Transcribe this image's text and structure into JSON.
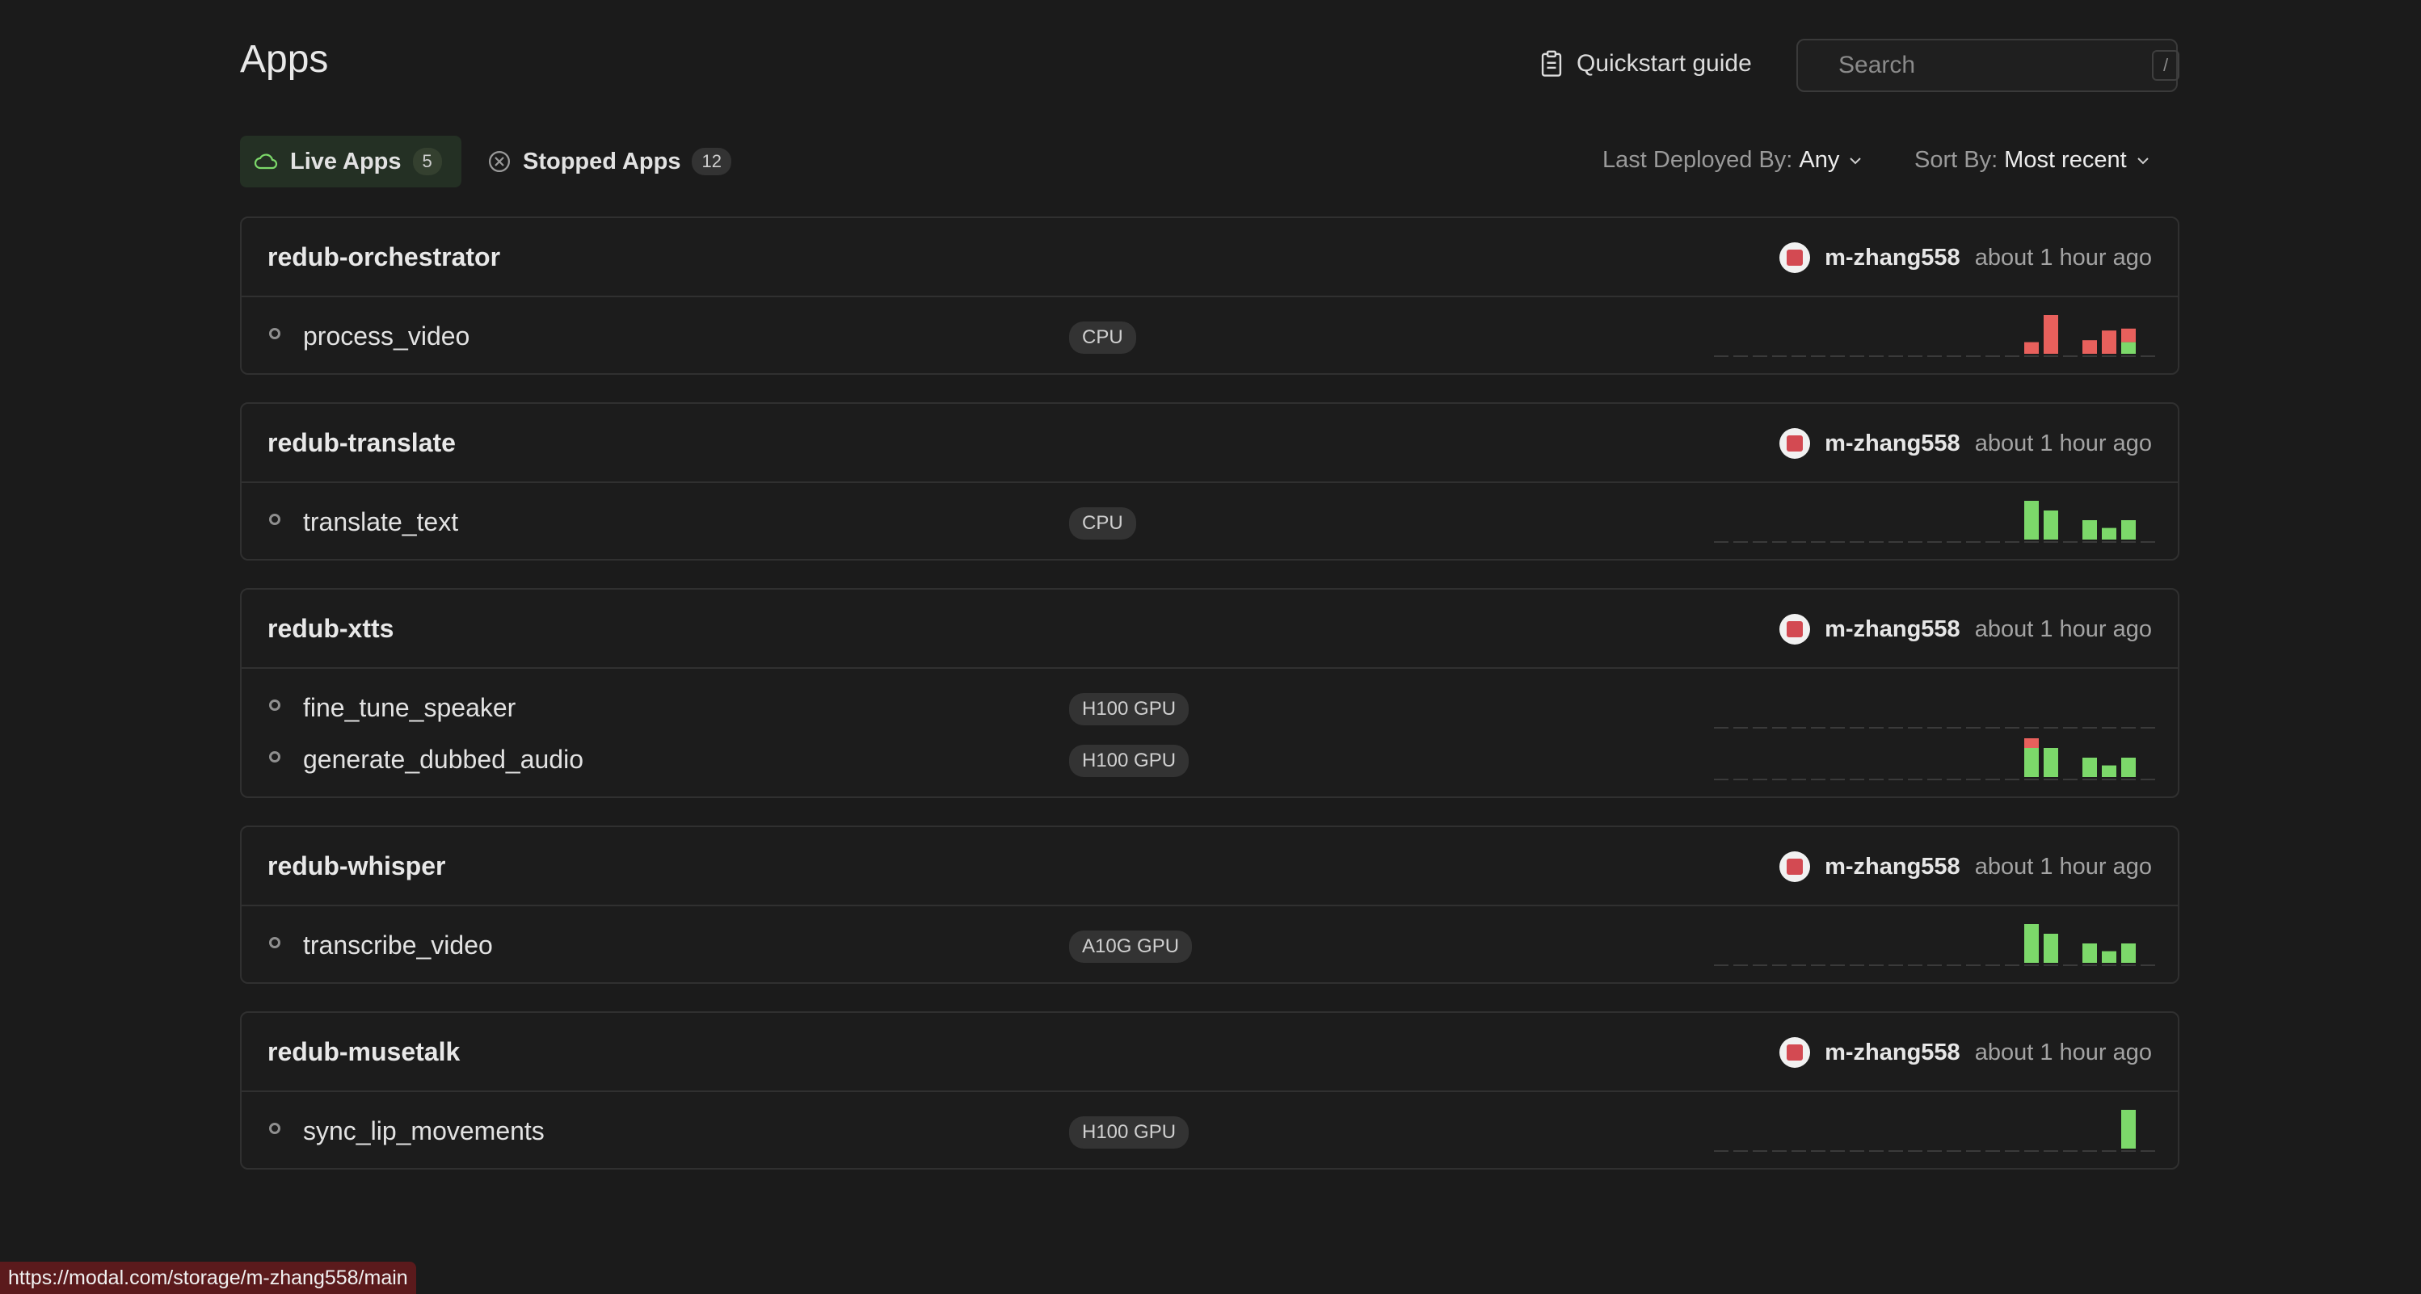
{
  "header": {
    "title": "Apps",
    "quickstart_label": "Quickstart guide",
    "search_placeholder": "Search",
    "search_shortcut": "/"
  },
  "tabs": [
    {
      "label": "Live Apps",
      "count": "5",
      "active": true
    },
    {
      "label": "Stopped Apps",
      "count": "12",
      "active": false
    }
  ],
  "filters": {
    "deployed_by_label": "Last Deployed By:",
    "deployed_by_value": "Any",
    "sort_label": "Sort By:",
    "sort_value": "Most recent"
  },
  "colors": {
    "success": "#7cd86a",
    "failure": "#e8605c",
    "dash": "#3a3a3a"
  },
  "apps": [
    {
      "name": "redub-orchestrator",
      "user": "m-zhang558",
      "time": "about 1 hour ago",
      "functions": [
        {
          "name": "process_video",
          "resource": "CPU",
          "activity": [
            [
              0,
              0
            ],
            [
              0,
              0
            ],
            [
              0,
              0
            ],
            [
              0,
              0
            ],
            [
              0,
              0
            ],
            [
              0,
              0
            ],
            [
              0,
              0
            ],
            [
              0,
              0
            ],
            [
              0,
              0
            ],
            [
              0,
              0
            ],
            [
              0,
              0
            ],
            [
              0,
              0
            ],
            [
              0,
              0
            ],
            [
              0,
              0
            ],
            [
              0,
              0
            ],
            [
              0,
              0
            ],
            [
              0,
              0.3
            ],
            [
              0,
              1
            ],
            [
              0,
              0
            ],
            [
              0,
              0.35
            ],
            [
              0,
              0.6
            ],
            [
              0.3,
              0.35
            ],
            [
              0,
              0
            ]
          ]
        }
      ]
    },
    {
      "name": "redub-translate",
      "user": "m-zhang558",
      "time": "about 1 hour ago",
      "functions": [
        {
          "name": "translate_text",
          "resource": "CPU",
          "activity": [
            [
              0,
              0
            ],
            [
              0,
              0
            ],
            [
              0,
              0
            ],
            [
              0,
              0
            ],
            [
              0,
              0
            ],
            [
              0,
              0
            ],
            [
              0,
              0
            ],
            [
              0,
              0
            ],
            [
              0,
              0
            ],
            [
              0,
              0
            ],
            [
              0,
              0
            ],
            [
              0,
              0
            ],
            [
              0,
              0
            ],
            [
              0,
              0
            ],
            [
              0,
              0
            ],
            [
              0,
              0
            ],
            [
              1,
              0
            ],
            [
              0.75,
              0
            ],
            [
              0,
              0
            ],
            [
              0.5,
              0
            ],
            [
              0.3,
              0
            ],
            [
              0.5,
              0
            ],
            [
              0,
              0
            ]
          ]
        }
      ]
    },
    {
      "name": "redub-xtts",
      "user": "m-zhang558",
      "time": "about 1 hour ago",
      "functions": [
        {
          "name": "fine_tune_speaker",
          "resource": "H100 GPU",
          "activity": [
            [
              0,
              0
            ],
            [
              0,
              0
            ],
            [
              0,
              0
            ],
            [
              0,
              0
            ],
            [
              0,
              0
            ],
            [
              0,
              0
            ],
            [
              0,
              0
            ],
            [
              0,
              0
            ],
            [
              0,
              0
            ],
            [
              0,
              0
            ],
            [
              0,
              0
            ],
            [
              0,
              0
            ],
            [
              0,
              0
            ],
            [
              0,
              0
            ],
            [
              0,
              0
            ],
            [
              0,
              0
            ],
            [
              0,
              0
            ],
            [
              0,
              0
            ],
            [
              0,
              0
            ],
            [
              0,
              0
            ],
            [
              0,
              0
            ],
            [
              0,
              0
            ],
            [
              0,
              0
            ]
          ]
        },
        {
          "name": "generate_dubbed_audio",
          "resource": "H100 GPU",
          "activity": [
            [
              0,
              0
            ],
            [
              0,
              0
            ],
            [
              0,
              0
            ],
            [
              0,
              0
            ],
            [
              0,
              0
            ],
            [
              0,
              0
            ],
            [
              0,
              0
            ],
            [
              0,
              0
            ],
            [
              0,
              0
            ],
            [
              0,
              0
            ],
            [
              0,
              0
            ],
            [
              0,
              0
            ],
            [
              0,
              0
            ],
            [
              0,
              0
            ],
            [
              0,
              0
            ],
            [
              0,
              0
            ],
            [
              0.75,
              0.25
            ],
            [
              0.75,
              0
            ],
            [
              0,
              0
            ],
            [
              0.5,
              0
            ],
            [
              0.3,
              0
            ],
            [
              0.5,
              0
            ],
            [
              0,
              0
            ]
          ]
        }
      ]
    },
    {
      "name": "redub-whisper",
      "user": "m-zhang558",
      "time": "about 1 hour ago",
      "functions": [
        {
          "name": "transcribe_video",
          "resource": "A10G GPU",
          "activity": [
            [
              0,
              0
            ],
            [
              0,
              0
            ],
            [
              0,
              0
            ],
            [
              0,
              0
            ],
            [
              0,
              0
            ],
            [
              0,
              0
            ],
            [
              0,
              0
            ],
            [
              0,
              0
            ],
            [
              0,
              0
            ],
            [
              0,
              0
            ],
            [
              0,
              0
            ],
            [
              0,
              0
            ],
            [
              0,
              0
            ],
            [
              0,
              0
            ],
            [
              0,
              0
            ],
            [
              0,
              0
            ],
            [
              1,
              0
            ],
            [
              0.75,
              0
            ],
            [
              0,
              0
            ],
            [
              0.5,
              0
            ],
            [
              0.3,
              0
            ],
            [
              0.5,
              0
            ],
            [
              0,
              0
            ]
          ]
        }
      ]
    },
    {
      "name": "redub-musetalk",
      "user": "m-zhang558",
      "time": "about 1 hour ago",
      "functions": [
        {
          "name": "sync_lip_movements",
          "resource": "H100 GPU",
          "activity": [
            [
              0,
              0
            ],
            [
              0,
              0
            ],
            [
              0,
              0
            ],
            [
              0,
              0
            ],
            [
              0,
              0
            ],
            [
              0,
              0
            ],
            [
              0,
              0
            ],
            [
              0,
              0
            ],
            [
              0,
              0
            ],
            [
              0,
              0
            ],
            [
              0,
              0
            ],
            [
              0,
              0
            ],
            [
              0,
              0
            ],
            [
              0,
              0
            ],
            [
              0,
              0
            ],
            [
              0,
              0
            ],
            [
              0,
              0
            ],
            [
              0,
              0
            ],
            [
              0,
              0
            ],
            [
              0,
              0
            ],
            [
              0,
              0
            ],
            [
              1,
              0
            ],
            [
              0,
              0
            ]
          ]
        }
      ]
    }
  ],
  "status_bar_url": "https://modal.com/storage/m-zhang558/main"
}
